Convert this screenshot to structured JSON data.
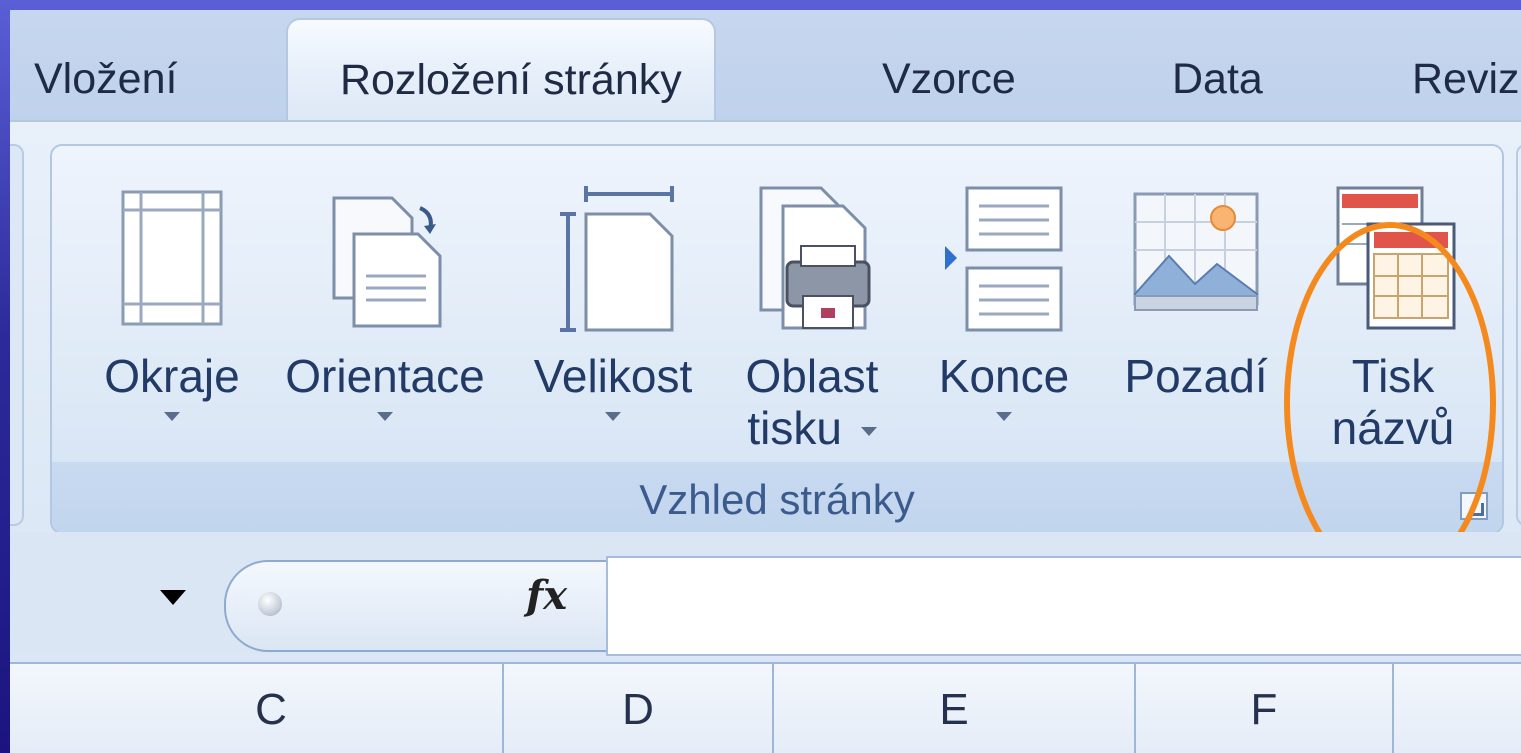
{
  "tabs": [
    {
      "label": "Vložení",
      "active": false
    },
    {
      "label": "Rozložení stránky",
      "active": true
    },
    {
      "label": "Vzorce",
      "active": false
    },
    {
      "label": "Data",
      "active": false
    },
    {
      "label": "Reviz",
      "active": false
    }
  ],
  "group": {
    "label": "Vzhled stránky",
    "buttons": [
      {
        "line1": "Okraje",
        "line2": "",
        "icon": "margins-icon",
        "dropdown": true
      },
      {
        "line1": "Orientace",
        "line2": "",
        "icon": "orientation-icon",
        "dropdown": true
      },
      {
        "line1": "Velikost",
        "line2": "",
        "icon": "size-icon",
        "dropdown": true
      },
      {
        "line1": "Oblast",
        "line2": "tisku",
        "icon": "print-area-icon",
        "dropdown": true
      },
      {
        "line1": "Konce",
        "line2": "",
        "icon": "breaks-icon",
        "dropdown": true
      },
      {
        "line1": "Pozadí",
        "line2": "",
        "icon": "background-icon",
        "dropdown": false
      },
      {
        "line1": "Tisk",
        "line2": "názvů",
        "icon": "print-titles-icon",
        "dropdown": false
      }
    ]
  },
  "formula_bar": {
    "fx_label": "fx",
    "value": ""
  },
  "columns": [
    "C",
    "D",
    "E",
    "F"
  ],
  "colors": {
    "highlight": "#f48a1e",
    "background": "#2c2a9a"
  }
}
